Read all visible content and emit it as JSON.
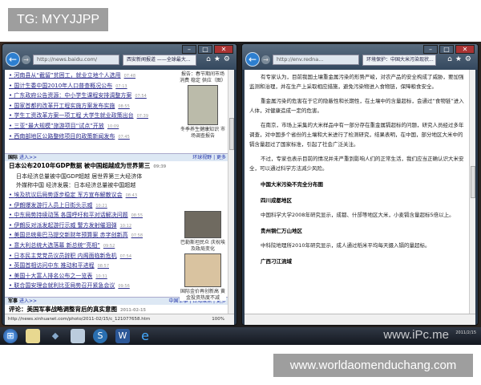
{
  "tag": "TG: MYYJJPP",
  "site_watermark": "www.worldaomenduchang.com",
  "screen_watermark": "www.iPc.me",
  "left_window": {
    "address": "http://news.baidu.com/",
    "tab": "西安新闻报道 ——全球最大...",
    "status_url": "http://news.xinhuanet.com/photo/2011-02/15/c_121077658.htm",
    "zoom": "100%",
    "news_top": [
      {
        "text": "河南县从“截留”贫困工，就业立地个人选用",
        "time": "07:48"
      },
      {
        "text": "国计生委中国2010年人口普查概况公布",
        "time": "07:13"
      },
      {
        "text": "广东政府公告资源：中小学生课程安排调整方案",
        "time": "07:54"
      },
      {
        "text": "国家首都的改革开工程实施方案发布实施",
        "time": "08:55"
      },
      {
        "text": "学生工资改革方案一项工程 大学生就业政策出台",
        "time": "07:39"
      },
      {
        "text": "三亚“最大规模”旅游项目“试点”开放",
        "time": "10:09"
      },
      {
        "text": "西南部地区公路整修项目的政策新闻发布",
        "time": "07:45"
      }
    ],
    "side_caption_1": "报告：春节期间市场消费 稳定 供应（图）",
    "side_caption_2": "冬季养生健康知识 市场调查报告",
    "section_1": {
      "name": "国际",
      "more": "进入>>",
      "links": "环球视野 | 更多"
    },
    "headline": {
      "text": "日本公布2010年GDP数据 被中国超越成为世界第三",
      "time": "09:39"
    },
    "headline_subs": [
      "日本经济总量被中国GDP超越 居世界第三大经济体",
      "外媒称中国 经济发展：日本经济总量被中国超越"
    ],
    "news_bottom": [
      {
        "text": "埃及抗议后局势逐步稳定 军方宣布解散议会",
        "time": "08:43"
      },
      {
        "text": "伊朗爆发游行人员上日街头示威",
        "time": "10:21"
      },
      {
        "text": "中东局势持续动荡 各国呼吁和平对话解决问题",
        "time": "08:55"
      },
      {
        "text": "伊朗反对派发起游行示威 警方发射催泪弹",
        "time": "10:12"
      },
      {
        "text": "美国总统奥巴马提交新财年预算案 赤字创新高",
        "time": "07:58"
      },
      {
        "text": "意大利总统大选落幕 新总统“亮相”",
        "time": "09:52"
      },
      {
        "text": "日本民主党党员议员辞职 内阁面临新危机",
        "time": "07:54"
      },
      {
        "text": "英国首相访问中东 推动和平进程",
        "time": "08:57"
      },
      {
        "text": "美国十大富人排名公布之一览表",
        "time": "10:31"
      },
      {
        "text": "联合国安理会就利比亚局势召开紧急会议",
        "time": "09:56"
      }
    ],
    "side_caption_3": "巴勒斯坦民众 庆祝埃及政局变化",
    "side_caption_4": "国际金价再创新高 黄金投资热度不减",
    "section_2": {
      "name": "军事",
      "more": "进入>>",
      "links": "中国军事 | 台海聚焦 | 更多"
    },
    "last_item": "评论：美国军事战略调整背后的真实意图",
    "last_time": "2011-02-15"
  },
  "right_window": {
    "address": "http://env.redna...",
    "tab": "环境保护：中国大米污染现状...",
    "paragraphs": [
      "有专家认为，目前我国土壤重金属污染的形势严峻，对农产品的安全构成了威胁，要加强监测和治理，并在生产上采取相应措施，避免污染物进入食物链，保障粮食安全。",
      "重金属污染的危害在于它的隐蔽性和长期性，在土壤中的含量超标，会通过“食物链”进入人体，对健康造成一定的危害。",
      "在南京，市场上采集的大米样品中有一部分存在重金属镉超标的问题，研究人员经过多年调查，对中国多个省份的土壤和大米进行了检测研究，结果表明，在中国，部分地区大米中的镉含量超过了国家标准，引起了社会广泛关注。",
      "不过，专家也表示目前的情况并未严重到影响人们的正常生活，我们应当正确认识大米安全，可以通过科学方法减少风险。"
    ],
    "sections": [
      {
        "title": "中国大米污染不完全分布图",
        "text": ""
      },
      {
        "title": "四川成都地区",
        "text": "中国科学大学2008年研究显示，成都、什邡等地区大米，小麦镉含量超标5倍以上。"
      },
      {
        "title": "贵州铜仁万山地区",
        "text": "中科院地理所2010年研究显示，成人通过稻米平均每天摄入镉的量超标。"
      },
      {
        "title": "广西刁江流域",
        "text": ""
      }
    ]
  },
  "taskbar": {
    "apps": [
      "start",
      "explorer",
      "folder",
      "notepad",
      "sogou",
      "word",
      "ie"
    ],
    "date": "2011/2/15"
  }
}
